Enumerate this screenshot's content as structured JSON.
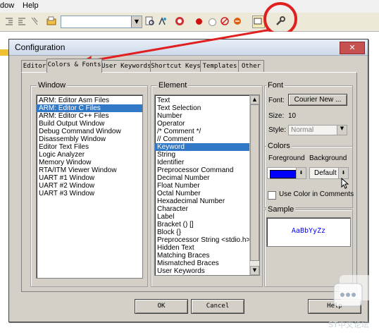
{
  "menubar": {
    "items": [
      "dow",
      "Help"
    ]
  },
  "dialog": {
    "title": "Configuration",
    "close_label": "✕",
    "tabs": [
      "Editor",
      "Colors & Fonts",
      "User Keywords",
      "Shortcut Keys",
      "Templates",
      "Other"
    ],
    "active_tab": "Colors & Fonts",
    "window_group": {
      "label": "Window",
      "items": [
        "ARM: Editor Asm Files",
        "ARM: Editor C Files",
        "ARM: Editor C++ Files",
        "Build Output Window",
        "Debug Command Window",
        "Disassembly Window",
        "Editor Text Files",
        "Logic Analyzer",
        "Memory Window",
        "RTA/ITM Viewer Window",
        "UART #1 Window",
        "UART #2 Window",
        "UART #3 Window"
      ],
      "selected": "ARM: Editor C Files"
    },
    "element_group": {
      "label": "Element",
      "items": [
        "Text",
        "Text Selection",
        "Number",
        "Operator",
        "/* Comment */",
        "// Comment",
        "Keyword",
        "String",
        "Identifier",
        "Preprocessor Command",
        "Decimal Number",
        "Float Number",
        "Octal Number",
        "Hexadecimal Number",
        "Character",
        "Label",
        "Bracket () []",
        "Block {}",
        "Preprocessor String <stdio.h>",
        "Hidden Text",
        "Matching Braces",
        "Mismatched Braces",
        "User Keywords"
      ],
      "selected": "Keyword"
    },
    "font_group": {
      "label": "Font",
      "font_label": "Font:",
      "font_button": "Courier New ...",
      "size_label": "Size:",
      "size_value": "10",
      "style_label": "Style:",
      "style_value": "Normal"
    },
    "colors_group": {
      "label": "Colors",
      "foreground_label": "Foreground",
      "background_label": "Background",
      "foreground_color": "#0000ff",
      "background_value": "Default",
      "checkbox_label": "Use Color in Comments"
    },
    "sample_group": {
      "label": "Sample",
      "sample_text": "AaBbYyZz"
    },
    "buttons": {
      "ok": "OK",
      "cancel": "Cancel",
      "help": "Help"
    }
  },
  "watermark": {
    "text": "ST中文论坛"
  }
}
